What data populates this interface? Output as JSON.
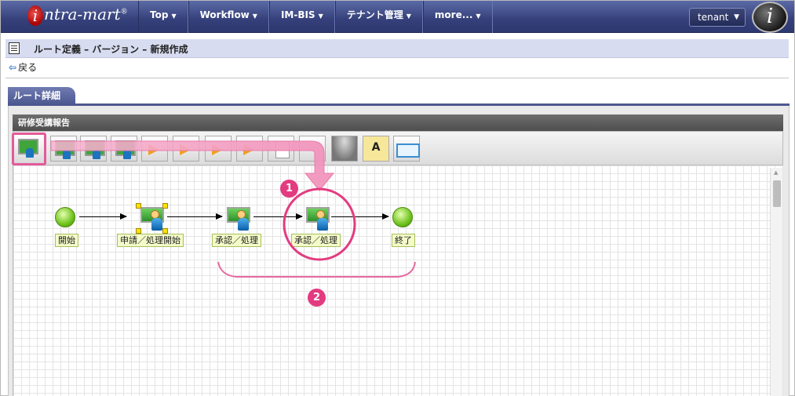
{
  "header": {
    "logo_text": "intra-mart",
    "nav": [
      {
        "label": "Top"
      },
      {
        "label": "Workflow"
      },
      {
        "label": "IM-BIS"
      },
      {
        "label": "テナント管理"
      },
      {
        "label": "more..."
      }
    ],
    "tenant_label": "tenant",
    "user_icon": "user-avatar-icon"
  },
  "page": {
    "title": "ルート定義 – バージョン – 新規作成",
    "back_label": "戻る",
    "tab_label": "ルート詳細"
  },
  "route": {
    "panel_title": "研修受講報告",
    "toolbar_icons": [
      "task-node-tool-icon",
      "task-node-tool-icon",
      "task-node-tool-icon",
      "task-node-tool-icon",
      "branch-tool-icon",
      "branch-tool-icon",
      "join-tool-icon",
      "join-tool-icon",
      "document-tool-icon",
      "user-tool-icon",
      "database-tool-icon",
      "text-tool-icon",
      "frame-tool-icon"
    ],
    "text_tool_glyph": "A",
    "nodes": [
      {
        "label": "開始",
        "type": "start"
      },
      {
        "label": "申請／処理開始",
        "type": "task"
      },
      {
        "label": "承認／処理",
        "type": "task"
      },
      {
        "label": "承認／処理",
        "type": "task"
      },
      {
        "label": "終了",
        "type": "end"
      }
    ]
  },
  "annotations": {
    "badge_1": "1",
    "badge_2": "2",
    "accent_color": "#e33b80"
  }
}
